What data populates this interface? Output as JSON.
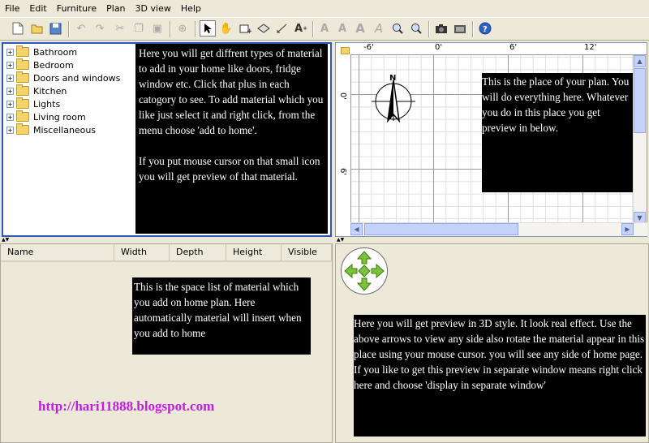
{
  "menu": [
    "File",
    "Edit",
    "Furniture",
    "Plan",
    "3D view",
    "Help"
  ],
  "catalog": {
    "categories": [
      "Bathroom",
      "Bedroom",
      "Doors and windows",
      "Kitchen",
      "Lights",
      "Living room",
      "Miscellaneous"
    ],
    "note_p1": "Here you will get diffrent types of material to add in your home like doors, fridge window etc. Click that plus in each catogory to see. To add material which you like just select it and right click, from the menu choose 'add to home'.",
    "note_p2": "If you put mouse cursor on that small icon you will get preview of that material."
  },
  "plan": {
    "ruler_top": [
      "-6'",
      "0'",
      "6'",
      "12'"
    ],
    "ruler_left": [
      "0'",
      "6'"
    ],
    "compass_label": "N",
    "note": "This is the place of your plan. You will do everything here. Whatever you do in this place you get preview in below."
  },
  "furniture_table": {
    "columns": [
      "Name",
      "Width",
      "Depth",
      "Height",
      "Visible"
    ],
    "note": "This is the space list of material which you add on home plan. Here automatically material will insert when you add to home",
    "link": "http://hari11888.blogspot.com",
    "link_color": "#c21ee0"
  },
  "view3d": {
    "note_p1": "Here you will get preview in 3D style. It look real effect. Use the above arrows to view any side also rotate the material  appear in this place using your mouse cursor. you will see any side of home page.",
    "note_p2": "If you like to get this preview in separate window means right click here and choose 'display in separate window'"
  },
  "colors": {
    "selection_border": "#2b58b8",
    "note_bg": "#000000",
    "nav_arrow": "#7cc23a"
  },
  "toolbar_icons": [
    "new-file-icon",
    "open-icon",
    "save-icon",
    "undo-icon",
    "redo-icon",
    "cut-icon",
    "copy-icon",
    "paste-icon",
    "add-furniture-icon",
    "select-arrow-icon",
    "pan-hand-icon",
    "create-walls-icon",
    "create-rooms-icon",
    "create-dimensions-icon",
    "add-text-icon",
    "text-size-1-icon",
    "text-size-2-icon",
    "text-size-3-icon",
    "text-size-4-icon",
    "zoom-in-icon",
    "zoom-out-icon",
    "photo-icon",
    "video-icon",
    "help-icon"
  ]
}
